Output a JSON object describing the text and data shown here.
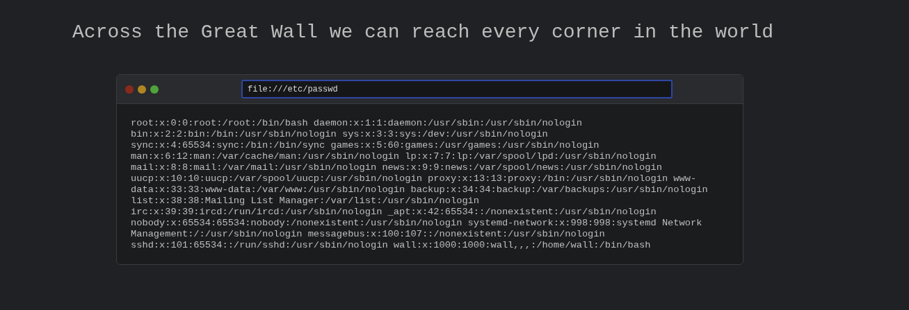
{
  "heading": "Across the Great Wall we can reach every corner in the world",
  "browser": {
    "window_buttons": [
      {
        "color": "#8b2a1a"
      },
      {
        "color": "#b08522"
      },
      {
        "color": "#4fa33b"
      }
    ],
    "address": {
      "value": "file:///etc/passwd"
    },
    "output_lines": [
      "root:x:0:0:root:/root:/bin/bash daemon:x:1:1:daemon:/usr/sbin:/usr/sbin/nologin",
      "bin:x:2:2:bin:/bin:/usr/sbin/nologin sys:x:3:3:sys:/dev:/usr/sbin/nologin",
      "sync:x:4:65534:sync:/bin:/bin/sync games:x:5:60:games:/usr/games:/usr/sbin/nologin",
      "man:x:6:12:man:/var/cache/man:/usr/sbin/nologin lp:x:7:7:lp:/var/spool/lpd:/usr/sbin/nologin",
      "mail:x:8:8:mail:/var/mail:/usr/sbin/nologin news:x:9:9:news:/var/spool/news:/usr/sbin/nologin",
      "uucp:x:10:10:uucp:/var/spool/uucp:/usr/sbin/nologin proxy:x:13:13:proxy:/bin:/usr/sbin/nologin www-",
      "data:x:33:33:www-data:/var/www:/usr/sbin/nologin backup:x:34:34:backup:/var/backups:/usr/sbin/nologin",
      "list:x:38:38:Mailing List Manager:/var/list:/usr/sbin/nologin",
      "irc:x:39:39:ircd:/run/ircd:/usr/sbin/nologin _apt:x:42:65534::/nonexistent:/usr/sbin/nologin",
      "nobody:x:65534:65534:nobody:/nonexistent:/usr/sbin/nologin systemd-network:x:998:998:systemd Network",
      "Management:/:/usr/sbin/nologin messagebus:x:100:107::/nonexistent:/usr/sbin/nologin",
      "sshd:x:101:65534::/run/sshd:/usr/sbin/nologin wall:x:1000:1000:wall,,,:/home/wall:/bin/bash"
    ]
  }
}
